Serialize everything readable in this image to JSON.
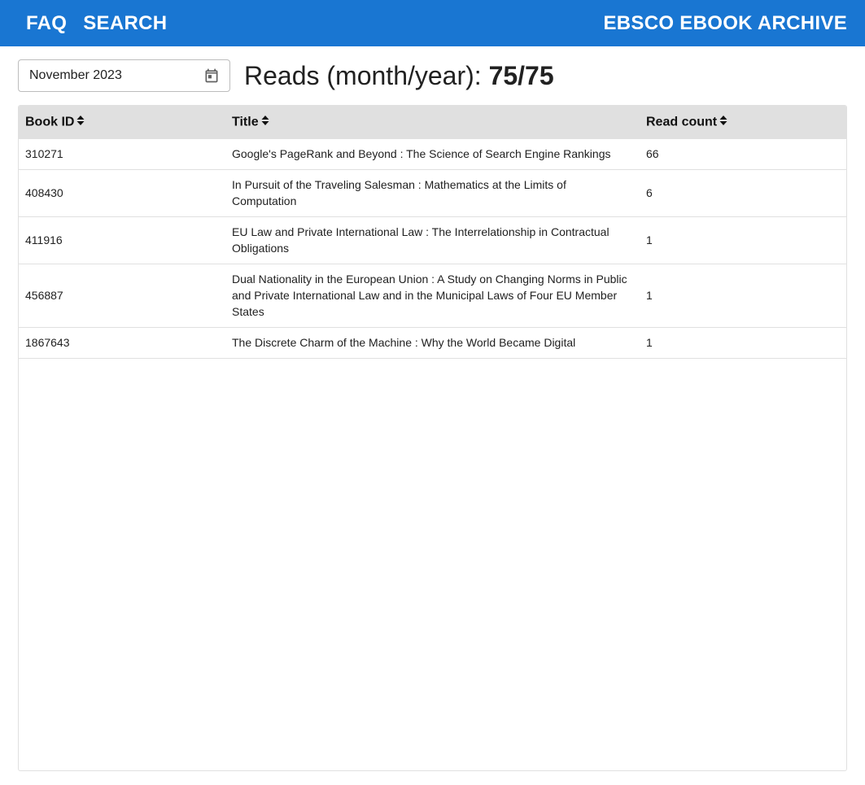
{
  "nav": {
    "faq": "FAQ",
    "search": "SEARCH",
    "brand": "EBSCO EBOOK ARCHIVE"
  },
  "filter": {
    "month_value": "November 2023",
    "calendar_icon": "calendar-icon"
  },
  "summary": {
    "label": "Reads (month/year):",
    "value": "75/75"
  },
  "table": {
    "headers": {
      "book_id": "Book ID",
      "title": "Title",
      "read_count": "Read count"
    },
    "rows": [
      {
        "id": "310271",
        "title": "Google's PageRank and Beyond : The Science of Search Engine Rankings",
        "count": "66"
      },
      {
        "id": "408430",
        "title": "In Pursuit of the Traveling Salesman : Mathematics at the Limits of Computation",
        "count": "6"
      },
      {
        "id": "411916",
        "title": "EU Law and Private International Law : The Interrelationship in Contractual Obligations",
        "count": "1"
      },
      {
        "id": "456887",
        "title": "Dual Nationality in the European Union : A Study on Changing Norms in Public and Private International Law and in the Municipal Laws of Four EU Member States",
        "count": "1"
      },
      {
        "id": "1867643",
        "title": "The Discrete Charm of the Machine : Why the World Became Digital",
        "count": "1"
      }
    ]
  },
  "colors": {
    "header_bar": "#1976d2",
    "table_header": "#e0e0e0"
  }
}
